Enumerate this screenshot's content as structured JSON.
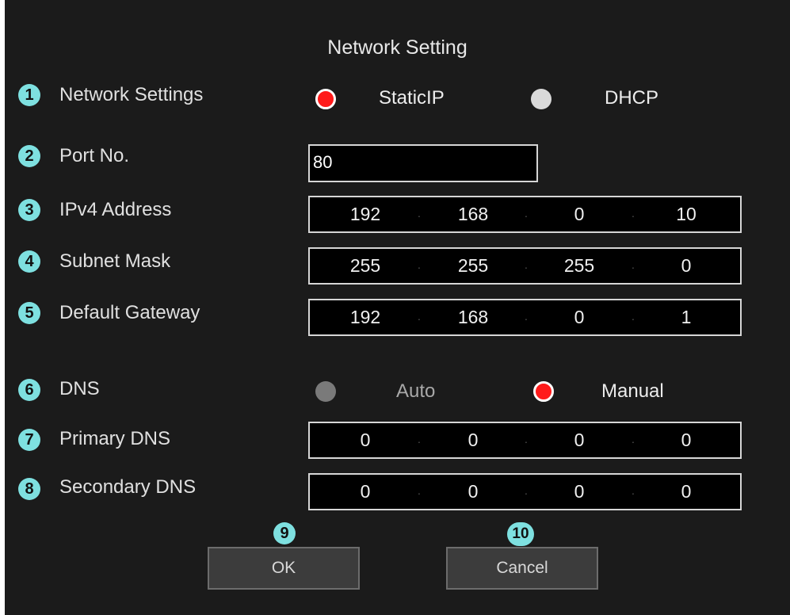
{
  "dialog": {
    "title": "Network Setting"
  },
  "badges": [
    "1",
    "2",
    "3",
    "4",
    "5",
    "6",
    "7",
    "8",
    "9",
    "10"
  ],
  "network_settings": {
    "label": "Network Settings",
    "options": [
      {
        "label": "StaticIP",
        "selected": true
      },
      {
        "label": "DHCP",
        "selected": false
      }
    ]
  },
  "port": {
    "label": "Port No.",
    "value": "80"
  },
  "ipv4": {
    "label": "IPv4 Address",
    "octets": [
      "192",
      "168",
      "0",
      "10"
    ]
  },
  "subnet": {
    "label": "Subnet Mask",
    "octets": [
      "255",
      "255",
      "255",
      "0"
    ]
  },
  "gateway": {
    "label": "Default Gateway",
    "octets": [
      "192",
      "168",
      "0",
      "1"
    ]
  },
  "dns": {
    "label": "DNS",
    "options": [
      {
        "label": "Auto",
        "selected": false
      },
      {
        "label": "Manual",
        "selected": true
      }
    ]
  },
  "primary_dns": {
    "label": "Primary DNS",
    "octets": [
      "0",
      "0",
      "0",
      "0"
    ]
  },
  "secondary_dns": {
    "label": "Secondary DNS",
    "octets": [
      "0",
      "0",
      "0",
      "0"
    ]
  },
  "buttons": {
    "ok": "OK",
    "cancel": "Cancel"
  },
  "colors": {
    "background": "#1b1b1b",
    "badge": "#7ee0e0",
    "radio_selected": "#ff1a1a"
  }
}
